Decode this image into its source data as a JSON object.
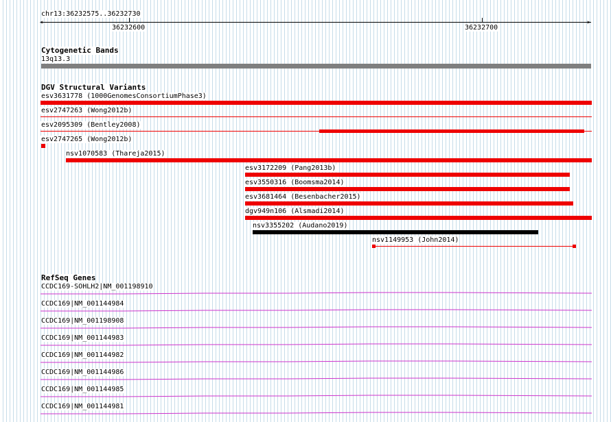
{
  "ruler": {
    "location": "chr13:36232575..36232730",
    "tick_labels": [
      "36232600",
      "36232700"
    ]
  },
  "cytoband": {
    "title": "Cytogenetic Bands",
    "band": "13q13.3"
  },
  "dgv": {
    "title": "DGV Structural Variants",
    "variants": [
      "esv3631778 (1000GenomesConsortiumPhase3)",
      "esv2747263 (Wong2012b)",
      "esv2095309 (Bentley2008)",
      "esv2747265 (Wong2012b)",
      "nsv1070583 (Thareja2015)",
      "esv3172209 (Pang2013b)",
      "esv3550316 (Boomsma2014)",
      "esv3681464 (Besenbacher2015)",
      "dgv949n106 (Alsmadi2014)",
      "nsv3355202 (Audano2019)",
      "nsv1149953 (John2014)"
    ]
  },
  "refseq": {
    "title": "RefSeq Genes",
    "genes": [
      "CCDC169-SOHLH2|NM_001198910",
      "CCDC169|NM_001144984",
      "CCDC169|NM_001198908",
      "CCDC169|NM_001144983",
      "CCDC169|NM_001144982",
      "CCDC169|NM_001144986",
      "CCDC169|NM_001144985",
      "CCDC169|NM_001144981"
    ]
  },
  "colors": {
    "variant_red": "#ee0000",
    "variant_black": "#000000",
    "band_gray": "#7f7f7f",
    "gene_magenta": "#cc33cc"
  }
}
